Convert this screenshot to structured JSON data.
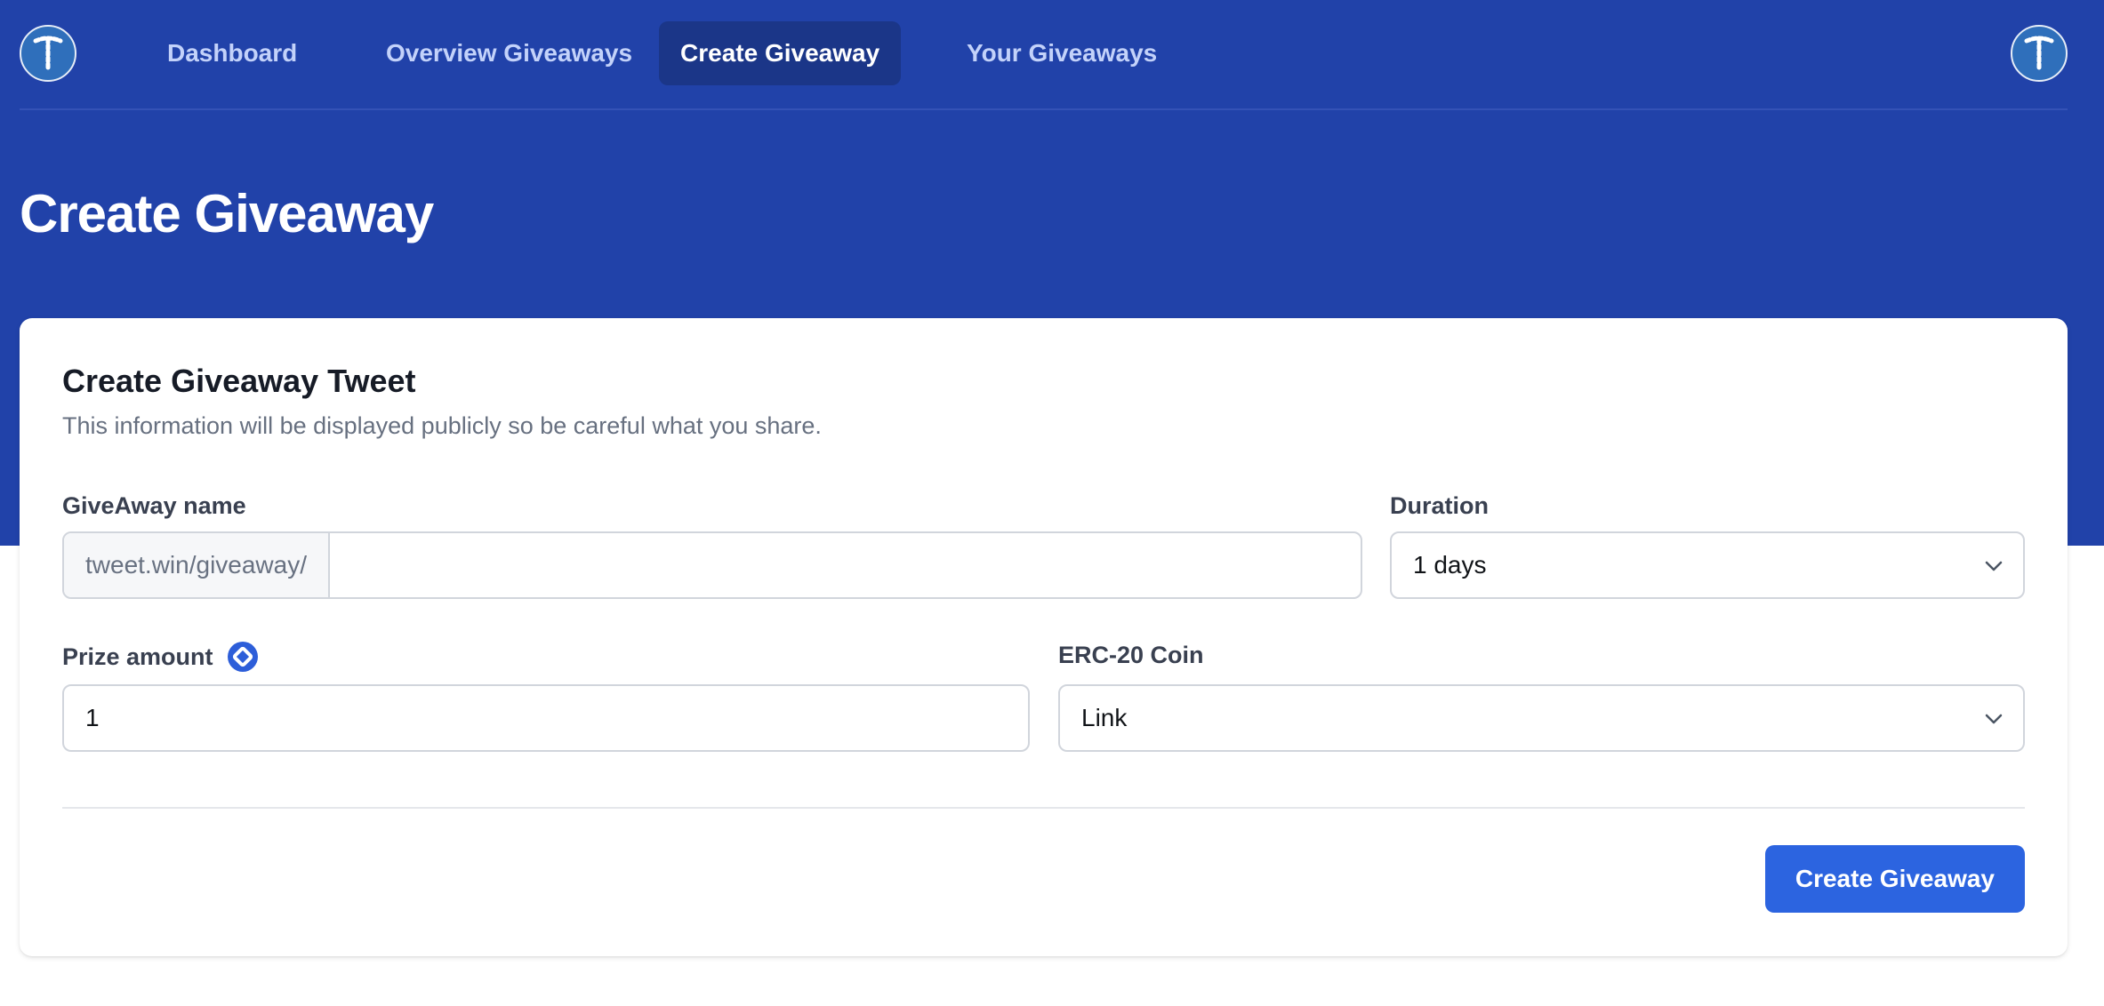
{
  "nav": {
    "items": [
      {
        "label": "Dashboard",
        "active": false
      },
      {
        "label": "Overview Giveaways",
        "active": false
      },
      {
        "label": "Create Giveaway",
        "active": true
      },
      {
        "label": "Your Giveaways",
        "active": false
      }
    ],
    "logo_icon": "tweet-win-logo-icon",
    "avatar_icon": "user-avatar-icon"
  },
  "page": {
    "title": "Create Giveaway"
  },
  "form": {
    "title": "Create Giveaway Tweet",
    "subtitle": "This information will be displayed publicly so be careful what you share.",
    "name": {
      "label": "GiveAway name",
      "prefix": "tweet.win/giveaway/",
      "value": ""
    },
    "duration": {
      "label": "Duration",
      "value": "1 days"
    },
    "prize": {
      "label": "Prize amount",
      "value": "1",
      "icon": "chainlink-icon"
    },
    "coin": {
      "label": "ERC-20 Coin",
      "value": "Link"
    },
    "submit_label": "Create Giveaway"
  },
  "colors": {
    "hero": "#2142a9",
    "nav_active": "#1b3688",
    "button": "#2c64e0"
  }
}
